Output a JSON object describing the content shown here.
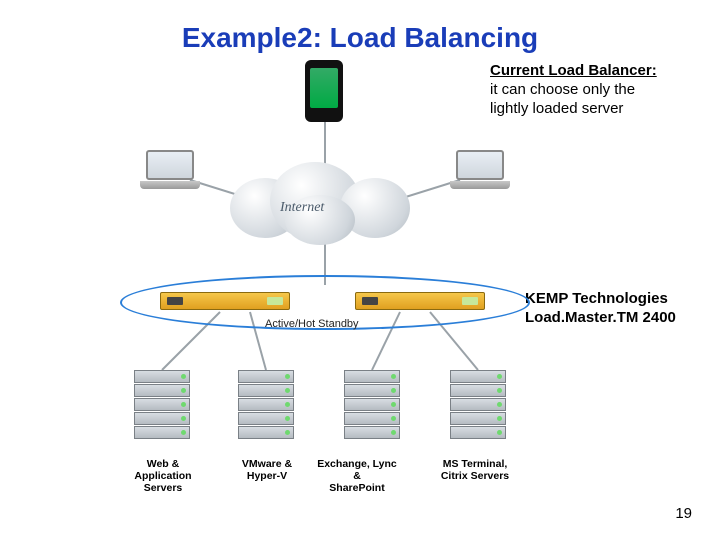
{
  "title": "Example2: Load Balancing",
  "annotation_top": {
    "heading": "Current Load Balancer:",
    "line1": "it can choose only the",
    "line2": "lightly loaded server"
  },
  "annotation_mid": {
    "line1": "KEMP Technologies",
    "line2": "Load.Master.TM 2400"
  },
  "cloud_label": "Internet",
  "lb_mode_label": "Active/Hot Standby",
  "rack_labels": {
    "r1a": "Web &",
    "r1b": "Application",
    "r1c": "Servers",
    "r2a": "VMware &",
    "r2b": "Hyper-V",
    "r3a": "Exchange, Lync &",
    "r3b": "SharePoint",
    "r4a": "MS Terminal,",
    "r4b": "Citrix Servers"
  },
  "page_number": "19"
}
